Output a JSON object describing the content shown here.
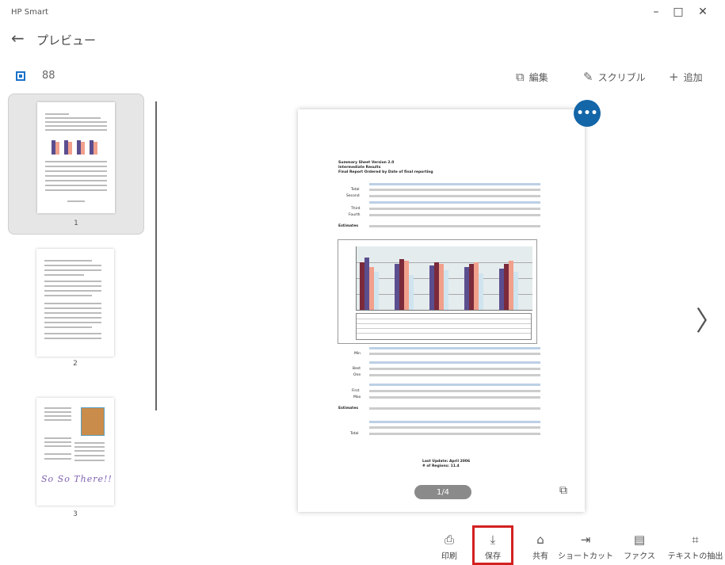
{
  "app": {
    "title": "HP Smart",
    "minimize": "–",
    "maximize": "□",
    "close": "✕"
  },
  "header": {
    "back_icon": "←",
    "title": "プレビュー"
  },
  "view_toggle": {
    "grid_icon": "88"
  },
  "toolbar": {
    "edit_label": "編集",
    "edit_icon": "⧉",
    "scribble_label": "スクリブル",
    "scribble_icon": "✎",
    "add_label": "追加",
    "add_icon": "+"
  },
  "thumbnails": [
    {
      "label": "1",
      "selected": true
    },
    {
      "label": "2",
      "selected": false
    },
    {
      "label": "3",
      "selected": false
    }
  ],
  "thumb3": {
    "script_text": "So So There!!"
  },
  "preview": {
    "more_icon": "•••",
    "page_indicator": "1/4",
    "rotate_icon": "⧉",
    "next_icon": "〉",
    "doc_title_1": "Summary Sheet Version 2.0",
    "doc_title_2": "Intermediate Results",
    "doc_title_3": "Final Report Ordered by Date of final reporting",
    "row_totals": "Total",
    "row_second": "Second",
    "row_third": "Third",
    "row_fourth": "Fourth",
    "row_estimates": "Estimates",
    "row_min": "Min",
    "row_best": "Best",
    "row_one": "One",
    "row_first": "First",
    "row_max": "Max",
    "row_total2": "Total",
    "footer_1": "Last Update: April 2006",
    "footer_2": "# of Regions: 11.4"
  },
  "actions": {
    "print_label": "印刷",
    "print_icon": "⎙",
    "save_label": "保存",
    "save_icon": "⤓",
    "share_label": "共有",
    "share_icon": "⌂",
    "shortcut_label": "ショートカット",
    "shortcut_icon": "⇥",
    "fax_label": "ファクス",
    "fax_icon": "▤",
    "extract_label": "テキストの抽出",
    "extract_icon": "⌗"
  },
  "colors": {
    "accent": "#1366a8",
    "highlight": "#d32020",
    "bar_purple": "#5b4e8f",
    "bar_salmon": "#f1a08c",
    "bar_lightblue": "#cfe4ee",
    "bar_darkred": "#7a2a3a"
  }
}
